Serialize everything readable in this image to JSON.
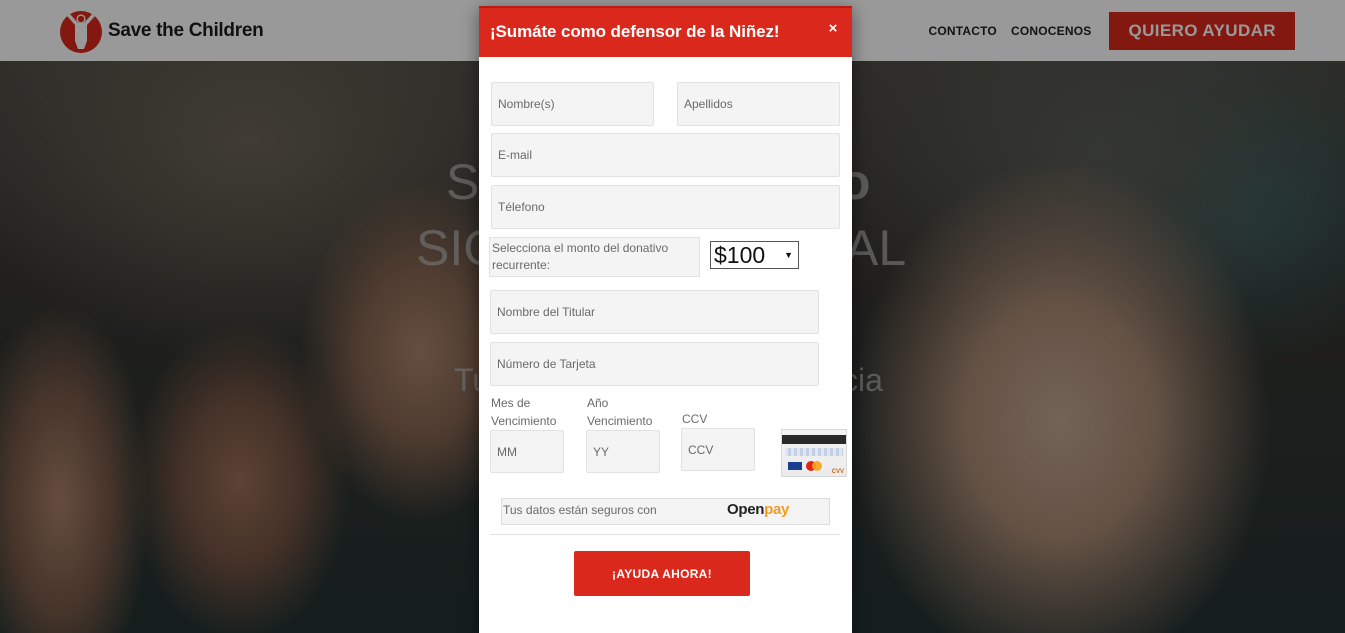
{
  "site": {
    "brand": "Save the Children",
    "nav": {
      "contact": "CONTACTO",
      "about": "CONOCENOS",
      "cta": "QUIERO AYUDAR"
    }
  },
  "hero": {
    "line1_start": "S",
    "line1_end": "ío",
    "line2_start": "SIG",
    "line2_end": "AL",
    "line3_start": "Tu",
    "line3_end": "cia"
  },
  "modal": {
    "title": "¡Sumáte como defensor de la Niñez!",
    "close_label": "×",
    "fields": {
      "nombre": "Nombre(s)",
      "apellidos": "Apellidos",
      "email": "E-mail",
      "telefono": "Télefono",
      "titular": "Nombre del Titular",
      "tarjeta": "Número de Tarjeta",
      "mm": "MM",
      "yy": "YY",
      "ccv": "CCV"
    },
    "monto": {
      "label": "Selecciona el monto del donativo recurrente:",
      "selected": "$100",
      "arrow": "▼"
    },
    "labels": {
      "mes": "Mes de Vencimiento",
      "anio": "Año Vencimiento",
      "ccv": "CCV"
    },
    "card_mark": "CVV",
    "secure": {
      "text": "Tus datos están seguros con",
      "brand_a": "Open",
      "brand_b": "pay"
    },
    "submit_label": "¡AYUDA AHORA!"
  },
  "colors": {
    "brand_red": "#da291c",
    "openpay_orange": "#f29c1f"
  }
}
